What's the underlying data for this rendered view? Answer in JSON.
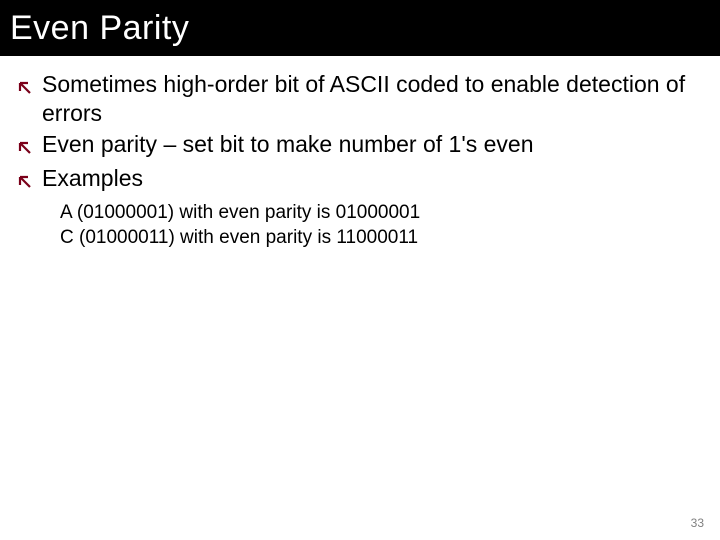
{
  "title": "Even Parity",
  "bullets": [
    {
      "text": "Sometimes high-order bit of ASCII coded to enable detection of errors"
    },
    {
      "text": "Even parity – set bit to make number of 1's even"
    },
    {
      "text": "Examples"
    }
  ],
  "examples": [
    "A (01000001) with even parity is 01000001",
    "C (01000011) with even parity is 11000011"
  ],
  "page_number": "33",
  "colors": {
    "title_bg": "#000000",
    "title_fg": "#ffffff",
    "bullet_arrow": "#7a0019",
    "body_text": "#000000",
    "page_num": "#808080"
  }
}
